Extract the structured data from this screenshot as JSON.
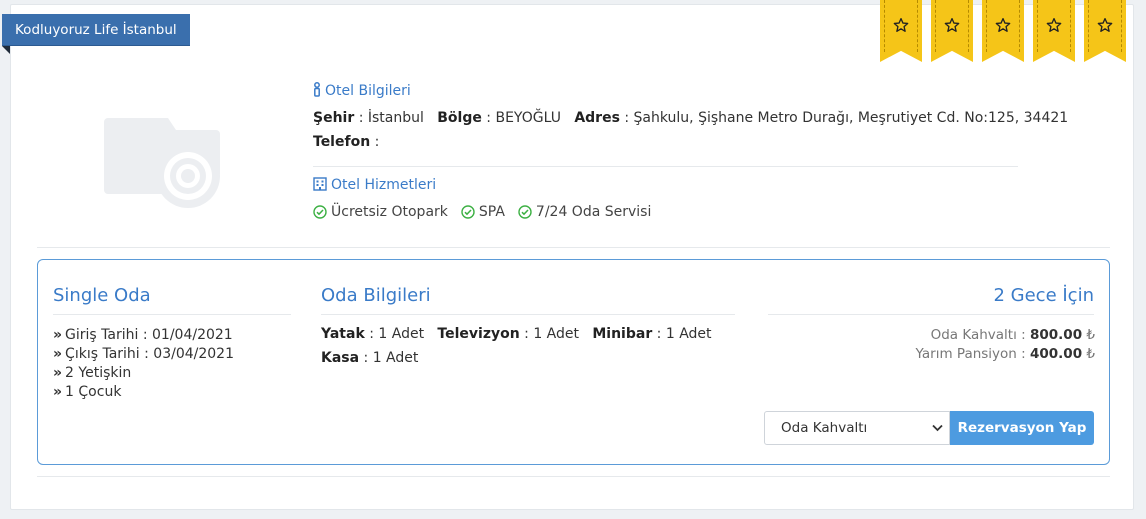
{
  "hotel": {
    "name": "Kodluyoruz Life İstanbul",
    "star_count": 5,
    "star_icon": "star-outline-icon",
    "photo_icon": "camera-icon"
  },
  "info": {
    "title": "Otel Bilgileri",
    "city_label": "Şehir",
    "city_value": "İstanbul",
    "region_label": "Bölge",
    "region_value": "BEYOĞLU",
    "address_label": "Adres",
    "address_value": "Şahkulu, Şişhane Metro Durağı, Meşrutiyet Cd. No:125, 34421",
    "phone_label": "Telefon",
    "phone_value": ""
  },
  "services": {
    "title": "Otel Hizmetleri",
    "items": [
      "Ücretsiz Otopark",
      "SPA",
      "7/24 Oda Servisi"
    ]
  },
  "room": {
    "name": "Single Oda",
    "details": [
      "Giriş Tarihi : 01/04/2021",
      "Çıkış Tarihi : 03/04/2021",
      "2 Yetişkin",
      "1 Çocuk"
    ],
    "info_title": "Oda Bilgileri",
    "features": {
      "bed_label": "Yatak",
      "bed_value": "1 Adet",
      "tv_label": "Televizyon",
      "tv_value": "1 Adet",
      "minibar_label": "Minibar",
      "minibar_value": "1 Adet",
      "safe_label": "Kasa",
      "safe_value": "1 Adet"
    },
    "nights_title": "2 Gece İçin",
    "prices": [
      {
        "label": "Oda Kahvaltı",
        "amount": "800.00",
        "currency": "₺"
      },
      {
        "label": "Yarım Pansiyon",
        "amount": "400.00",
        "currency": "₺"
      }
    ],
    "board_select_value": "Oda Kahvaltı",
    "reserve_button": "Rezervasyon Yap"
  },
  "colors": {
    "accent": "#3a7bc8",
    "ribbon": "#3a6fad",
    "star_tag": "#f5c518",
    "button": "#4d9be0",
    "check": "#3cb043"
  }
}
